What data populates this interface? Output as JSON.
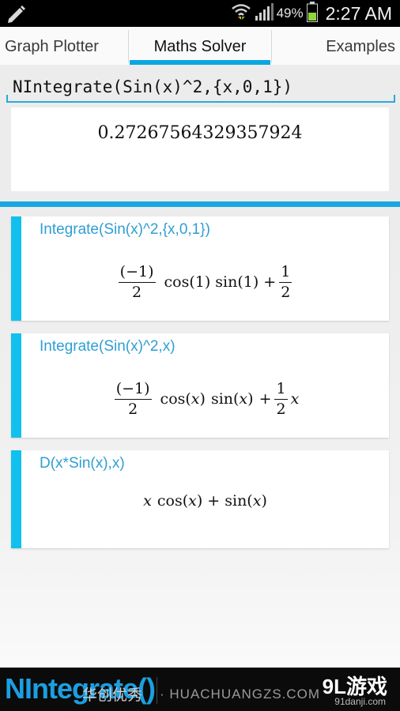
{
  "status_bar": {
    "battery_percent": "49%",
    "time": "2:27 AM",
    "icons": [
      "pencil-icon",
      "wifi-icon",
      "signal-icon",
      "battery-icon"
    ]
  },
  "tabs": [
    {
      "label": "Graph Plotter",
      "active": false
    },
    {
      "label": "Maths Solver",
      "active": true
    },
    {
      "label": "Examples",
      "active": false
    }
  ],
  "input": {
    "value": "NIntegrate(Sin(x)^2,{x,0,1})"
  },
  "result": "0.27267564329357924",
  "history": [
    {
      "query": "Integrate(Sin(x)^2,{x,0,1})",
      "math": {
        "frac1_num": "(−1)",
        "frac1_den": "2",
        "mid": "cos(1) sin(1) +",
        "frac2_num": "1",
        "frac2_den": "2"
      }
    },
    {
      "query": "Integrate(Sin(x)^2,x)",
      "math": {
        "frac1_num": "(−1)",
        "frac1_den": "2",
        "cos": "cos(",
        "x": "x",
        "close": ")",
        "sin": "sin(",
        "plus": "+",
        "frac2_num": "1",
        "frac2_den": "2",
        "tail": "x"
      }
    },
    {
      "query": "D(x*Sin(x),x)",
      "math": {
        "x1": "x",
        "cos": "cos(",
        "x2": "x",
        "mid": ") + sin(",
        "x3": "x",
        "close": ")"
      }
    }
  ],
  "banner": {
    "title": "NIntegrate()",
    "chinese": "华创优秀",
    "domain": "· HUACHUANGZS.COM",
    "logo": "9L游戏",
    "logo_sub": "91danji.com"
  },
  "colors": {
    "accent": "#1aa7e0",
    "card_bar": "#12c0ee",
    "query_text": "#2f9fd3"
  }
}
